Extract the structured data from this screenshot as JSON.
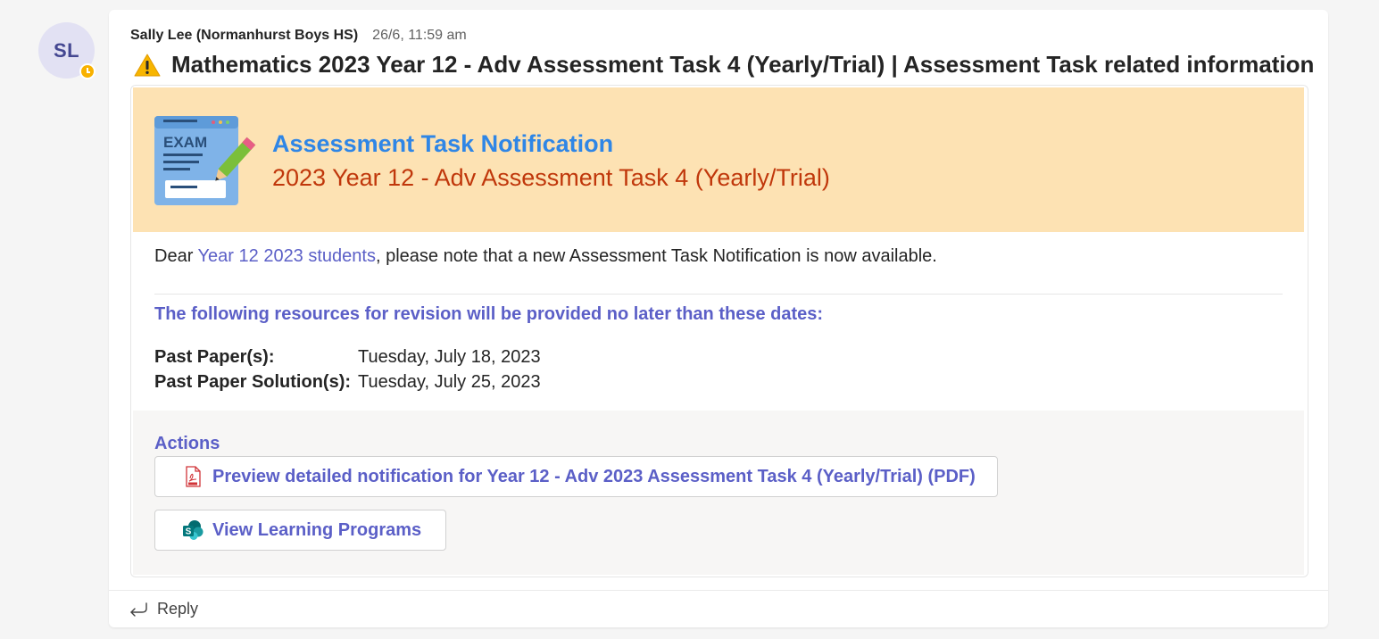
{
  "avatar": {
    "initials": "SL"
  },
  "message": {
    "author": "Sally Lee (Normanhurst Boys HS)",
    "timestamp": "26/6, 11:59 am",
    "subject": "Mathematics 2023 Year 12 - Adv Assessment Task 4 (Yearly/Trial) | Assessment Task related information"
  },
  "card": {
    "banner_title": "Assessment Task Notification",
    "banner_subtitle": "2023 Year 12 - Adv Assessment Task 4 (Yearly/Trial)",
    "exam_icon_label": "EXAM",
    "intro_prefix": "Dear ",
    "intro_mention": "Year 12 2023 students",
    "intro_suffix": ", please note that a new Assessment Task Notification is now available.",
    "resources_heading": "The following resources for revision will be provided no later than these dates:",
    "dates": [
      {
        "label": "Past Paper(s):",
        "value": "Tuesday, July 18, 2023"
      },
      {
        "label": "Past Paper Solution(s):",
        "value": "Tuesday, July 25, 2023"
      }
    ],
    "actions_heading": "Actions",
    "actions": [
      {
        "label": "Preview detailed notification for Year 12 - Adv 2023 Assessment Task 4 (Yearly/Trial) (PDF)",
        "icon": "pdf-icon"
      },
      {
        "label": "View Learning Programs",
        "icon": "sharepoint-icon"
      }
    ]
  },
  "reply": {
    "label": "Reply"
  },
  "colors": {
    "accent": "#5b5fc7",
    "banner_bg": "#fde2b3",
    "banner_title": "#2f86e6",
    "banner_subtitle": "#c0370b",
    "presence_away": "#f8b100"
  }
}
